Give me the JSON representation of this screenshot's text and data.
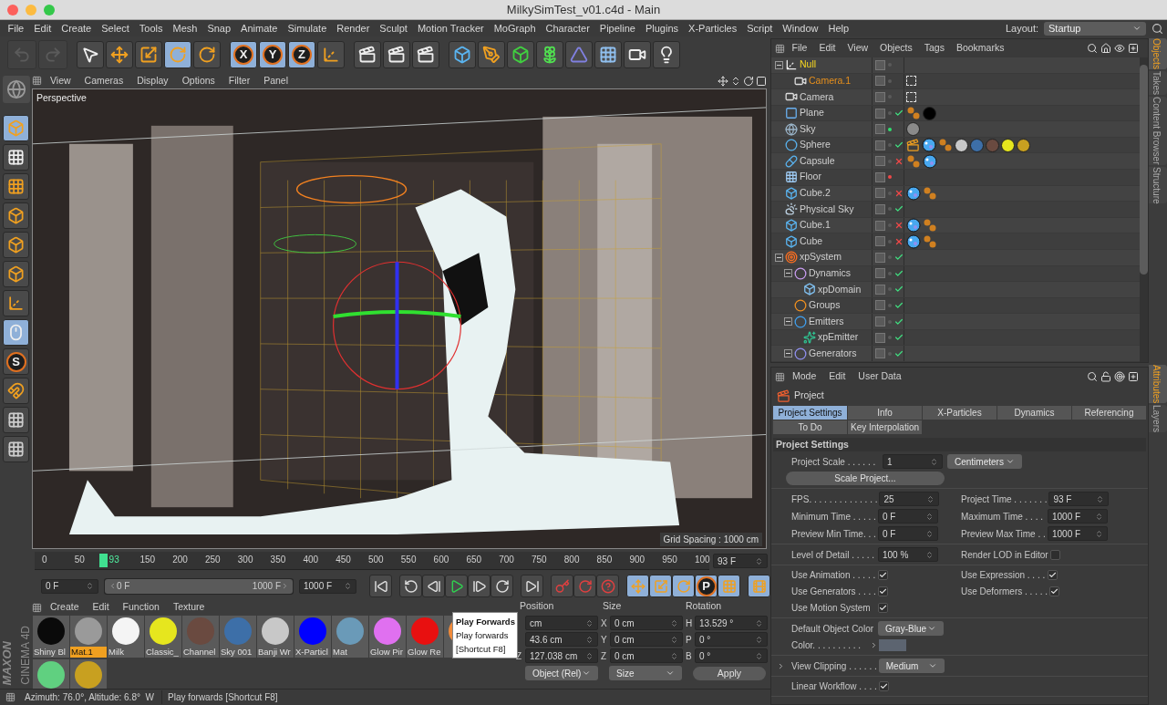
{
  "window": {
    "title": "MilkySimTest_v01.c4d - Main"
  },
  "menu": [
    "File",
    "Edit",
    "Create",
    "Select",
    "Tools",
    "Mesh",
    "Snap",
    "Animate",
    "Simulate",
    "Render",
    "Sculpt",
    "Motion Tracker",
    "MoGraph",
    "Character",
    "Pipeline",
    "Plugins",
    "X-Particles",
    "Script",
    "Window",
    "Help"
  ],
  "layout": {
    "label": "Layout:",
    "value": "Startup"
  },
  "toolbar": [
    [
      {
        "kind": "undo",
        "selected": false,
        "disabled": true
      },
      {
        "kind": "redo",
        "selected": false,
        "disabled": true
      }
    ],
    [
      {
        "kind": "select",
        "selected": false,
        "disabled": false
      },
      {
        "kind": "move",
        "selected": false,
        "disabled": false
      },
      {
        "kind": "scale",
        "selected": false,
        "disabled": false
      },
      {
        "kind": "rotate",
        "selected": true,
        "disabled": false
      },
      {
        "kind": "recent",
        "selected": false,
        "disabled": false
      }
    ],
    [
      {
        "kind": "axis",
        "label": "X",
        "selected": true,
        "disabled": false
      },
      {
        "kind": "axis",
        "label": "Y",
        "selected": true,
        "disabled": false
      },
      {
        "kind": "axis",
        "label": "Z",
        "selected": true,
        "disabled": false
      },
      {
        "kind": "coordinate-system",
        "selected": false,
        "disabled": false
      }
    ],
    [
      {
        "kind": "render-view",
        "selected": false,
        "disabled": false
      },
      {
        "kind": "render-picture",
        "selected": false,
        "disabled": false
      },
      {
        "kind": "render-settings",
        "selected": false,
        "disabled": false
      }
    ],
    [
      {
        "kind": "cube",
        "selected": false,
        "disabled": false
      },
      {
        "kind": "pen",
        "selected": false,
        "disabled": false
      },
      {
        "kind": "subdivision",
        "selected": false,
        "disabled": false
      },
      {
        "kind": "mograph",
        "selected": false,
        "disabled": false
      },
      {
        "kind": "deformer",
        "selected": false,
        "disabled": false
      },
      {
        "kind": "floor",
        "selected": false,
        "disabled": false
      },
      {
        "kind": "camera",
        "selected": false,
        "disabled": false
      },
      {
        "kind": "light",
        "selected": false,
        "disabled": false
      }
    ]
  ],
  "left_toolbar": [
    {
      "kind": "model",
      "selected": true
    },
    {
      "kind": "texture",
      "selected": false
    },
    {
      "kind": "workplane",
      "selected": false
    },
    {
      "kind": "points",
      "selected": false
    },
    {
      "kind": "edges",
      "selected": false
    },
    {
      "kind": "polygons",
      "selected": false
    },
    {
      "kind": "axis-mode",
      "selected": false
    },
    {
      "kind": "tweak",
      "selected": true
    },
    {
      "kind": "snap",
      "label": "S",
      "selected": false
    },
    {
      "kind": "magnet",
      "selected": false
    },
    {
      "kind": "lock-grid",
      "selected": false
    },
    {
      "kind": "grid-snap",
      "selected": false
    }
  ],
  "viewport": {
    "menu": [
      "View",
      "Cameras",
      "Display",
      "Options",
      "Filter",
      "Panel"
    ],
    "camera": "Perspective",
    "grid_spacing": "Grid Spacing : 1000 cm"
  },
  "timeline": {
    "ticks": [
      "0",
      "50",
      "150",
      "200",
      "250",
      "300",
      "350",
      "400",
      "450",
      "500",
      "550",
      "600",
      "650",
      "700",
      "750",
      "800",
      "850",
      "900",
      "950",
      "100"
    ],
    "current": "93",
    "level": 0.093,
    "frame": "93 F",
    "start": "0 F",
    "range": {
      "start": "0 F",
      "end": "1000 F",
      "level": 1
    },
    "end": "1000 F",
    "buttons": [
      [
        {
          "kind": "first-frame",
          "selected": false
        }
      ],
      [
        {
          "kind": "prev-key",
          "selected": false
        },
        {
          "kind": "prev-frame",
          "selected": false
        },
        {
          "kind": "play",
          "selected": false
        },
        {
          "kind": "next-frame",
          "selected": false
        },
        {
          "kind": "next-key",
          "selected": false
        }
      ],
      [
        {
          "kind": "last-frame",
          "selected": false
        }
      ],
      [
        {
          "kind": "record",
          "selected": false
        },
        {
          "kind": "auto-key",
          "selected": false
        },
        {
          "kind": "key-help",
          "selected": false
        }
      ],
      [
        {
          "kind": "move",
          "selected": true
        },
        {
          "kind": "scale",
          "selected": true
        },
        {
          "kind": "rotate",
          "selected": true
        },
        {
          "kind": "param",
          "label": "P",
          "selected": true
        },
        {
          "kind": "points-grid",
          "selected": true
        }
      ],
      [
        {
          "kind": "timeline",
          "selected": true
        }
      ]
    ]
  },
  "materials": {
    "logo": [
      "MAXON",
      "CINEMA 4D"
    ],
    "menu": [
      "Create",
      "Edit",
      "Function",
      "Texture"
    ],
    "items": [
      {
        "name": "Shiny Bl",
        "color": "#0a0a0a",
        "selected": false
      },
      {
        "name": "Mat.1",
        "color": "#9a9a9a",
        "selected": true
      },
      {
        "name": "Milk",
        "color": "#f4f4f4",
        "selected": false
      },
      {
        "name": "Classic_",
        "color": "#e6e61e",
        "selected": false
      },
      {
        "name": "Channel",
        "color": "#6a4a40",
        "selected": false
      },
      {
        "name": "Sky 001",
        "color": "#3d6fa8",
        "selected": false
      },
      {
        "name": "Banji Wr",
        "color": "#c8c8c8",
        "selected": false
      },
      {
        "name": "X-Particl",
        "color": "#0000ff",
        "selected": false
      },
      {
        "name": "Mat",
        "color": "#6a9ab8",
        "selected": false
      },
      {
        "name": "Glow Pir",
        "color": "#e070f0",
        "selected": false
      },
      {
        "name": "Glow Re",
        "color": "#e81010",
        "selected": false
      },
      {
        "color": "#f08a3a"
      },
      {
        "color": "#60d080"
      },
      {
        "color": "#c8a020"
      }
    ]
  },
  "tooltip": {
    "title": "Play Forwards",
    "text": "Play forwards",
    "shortcut": "[Shortcut F8]"
  },
  "coordinates": {
    "headers": [
      "Position",
      "Size",
      "Rotation"
    ],
    "rows": [
      {
        "position": {
          "value": "cm"
        },
        "size": {
          "axis": "X",
          "value": "0 cm"
        },
        "rotation": {
          "axis": "H",
          "value": "13.529 °"
        }
      },
      {
        "position": {
          "value": "43.6 cm"
        },
        "size": {
          "axis": "Y",
          "value": "0 cm"
        },
        "rotation": {
          "axis": "P",
          "value": "0 °"
        }
      },
      {
        "position": {
          "axis": "Z",
          "value": "127.038 cm"
        },
        "size": {
          "axis": "Z",
          "value": "0 cm"
        },
        "rotation": {
          "axis": "B",
          "value": "0 °"
        }
      }
    ],
    "mode": "Object (Rel)",
    "size_mode": "Size",
    "apply": "Apply"
  },
  "status_bar": {
    "view": "Azimuth: 76.0°, Altitude: 6.8°  W",
    "message": "Play forwards [Shortcut F8]"
  },
  "object_manager": {
    "menu": [
      "File",
      "Edit",
      "View",
      "Objects",
      "Tags",
      "Bookmarks"
    ],
    "objects": [
      {
        "name": "Null",
        "kind": "null",
        "selected": true,
        "expanded": true,
        "dots": {
          "color": "#5a5a5a"
        },
        "children": [
          {
            "name": "Camera.1",
            "kind": "camera",
            "selected": false,
            "dots": {
              "color": "#5a5a5a"
            },
            "tags": [
              {
                "kind": "target"
              }
            ]
          }
        ]
      },
      {
        "name": "Camera",
        "kind": "camera",
        "selected": false,
        "dots": {
          "color": "#5a5a5a"
        },
        "tags": [
          {
            "kind": "target"
          }
        ]
      },
      {
        "name": "Plane",
        "kind": "plane",
        "selected": false,
        "dots": {
          "color": "#5a5a5a"
        },
        "enabled": true,
        "tags": [
          {
            "kind": "particles"
          },
          {
            "kind": "material",
            "color": "#000000"
          }
        ]
      },
      {
        "name": "Sky",
        "kind": "sky",
        "selected": false,
        "dots": {
          "color": "#30e070"
        },
        "tags": [
          {
            "kind": "material",
            "color": "#8a8a8a"
          }
        ]
      },
      {
        "name": "Sphere",
        "kind": "sphere",
        "selected": false,
        "dots": {
          "color": "#5a5a5a"
        },
        "enabled": true,
        "tags": [
          {
            "kind": "render"
          },
          {
            "kind": "fluid"
          },
          {
            "kind": "particles"
          },
          {
            "kind": "material",
            "color": "#c8c8c8"
          },
          {
            "kind": "material",
            "color": "#3d6fa8"
          },
          {
            "kind": "material",
            "color": "#6a4a40"
          },
          {
            "kind": "material",
            "color": "#e6e61e"
          },
          {
            "kind": "material",
            "color": "#c8a020"
          }
        ]
      },
      {
        "name": "Capsule",
        "kind": "capsule",
        "selected": false,
        "dots": {
          "color": "#5a5a5a"
        },
        "enabled": false,
        "tags": [
          {
            "kind": "particles"
          },
          {
            "kind": "fluid"
          }
        ]
      },
      {
        "name": "Floor",
        "kind": "floor",
        "selected": false,
        "dots": {
          "color": "#f04848"
        }
      },
      {
        "name": "Cube.2",
        "kind": "cube",
        "selected": false,
        "dots": {
          "color": "#5a5a5a"
        },
        "enabled": false,
        "tags": [
          {
            "kind": "fluid"
          },
          {
            "kind": "particles"
          }
        ]
      },
      {
        "name": "Physical Sky",
        "kind": "physical-sky",
        "selected": false,
        "dots": {
          "color": "#5a5a5a"
        },
        "enabled": true
      },
      {
        "name": "Cube.1",
        "kind": "cube",
        "selected": false,
        "dots": {
          "color": "#5a5a5a"
        },
        "enabled": false,
        "tags": [
          {
            "kind": "fluid"
          },
          {
            "kind": "particles"
          }
        ]
      },
      {
        "name": "Cube",
        "kind": "cube",
        "selected": false,
        "dots": {
          "color": "#5a5a5a"
        },
        "enabled": false,
        "tags": [
          {
            "kind": "fluid"
          },
          {
            "kind": "particles"
          }
        ]
      },
      {
        "name": "xpSystem",
        "kind": "xp-system",
        "selected": false,
        "expanded": true,
        "dots": {
          "color": "#5a5a5a"
        },
        "enabled": true,
        "children": [
          {
            "name": "Dynamics",
            "kind": "xp-dynamics",
            "selected": false,
            "expanded": true,
            "dots": {
              "color": "#5a5a5a"
            },
            "enabled": true,
            "children": [
              {
                "name": "xpDomain",
                "kind": "xp-domain",
                "selected": false,
                "dots": {
                  "color": "#5a5a5a"
                },
                "enabled": true
              }
            ]
          },
          {
            "name": "Groups",
            "kind": "xp-groups",
            "selected": false,
            "dots": {
              "color": "#5a5a5a"
            },
            "enabled": true
          },
          {
            "name": "Emitters",
            "kind": "xp-emitters",
            "selected": false,
            "expanded": true,
            "dots": {
              "color": "#5a5a5a"
            },
            "enabled": true,
            "children": [
              {
                "name": "xpEmitter",
                "kind": "xp-emitter",
                "selected": false,
                "dots": {
                  "color": "#5a5a5a"
                },
                "enabled": true
              }
            ]
          },
          {
            "name": "Generators",
            "kind": "xp-generators",
            "selected": false,
            "expanded": true,
            "dots": {
              "color": "#5a5a5a"
            },
            "enabled": true
          }
        ]
      }
    ]
  },
  "side_tabs_top": [
    {
      "label": "Objects",
      "selected": true
    },
    {
      "label": "Takes",
      "selected": false
    },
    {
      "label": "Content Browser",
      "selected": false
    },
    {
      "label": "Structure",
      "selected": false
    }
  ],
  "side_tabs_bottom": [
    {
      "label": "Attributes",
      "selected": true
    },
    {
      "label": "Layers",
      "selected": false
    }
  ],
  "attributes": {
    "menu": [
      "Mode",
      "Edit",
      "User Data"
    ],
    "title": "Project",
    "tabs": [
      [
        {
          "label": "Project Settings",
          "selected": true
        },
        {
          "label": "Info",
          "selected": false
        },
        {
          "label": "X-Particles",
          "selected": false
        },
        {
          "label": "Dynamics",
          "selected": false
        },
        {
          "label": "Referencing",
          "selected": false
        }
      ],
      [
        {
          "label": "To Do",
          "selected": false
        },
        {
          "label": "Key Interpolation",
          "selected": false
        }
      ]
    ],
    "section": "Project Settings",
    "groups": [
      [
        [
          {
            "kind": "number-unit",
            "label": "Project Scale . . . . . .",
            "value": "1",
            "unit": "Centimeters"
          }
        ],
        [
          {
            "kind": "button",
            "label": "Scale Project..."
          }
        ]
      ],
      [
        [
          {
            "kind": "number",
            "label": "FPS. . . . . . . . . . . . . .",
            "value": "25"
          },
          {
            "kind": "number",
            "label": "Project Time . . . . . . .",
            "value": "93 F"
          }
        ],
        [
          {
            "kind": "number",
            "label": "Minimum Time . . . . .",
            "value": "0 F"
          },
          {
            "kind": "number",
            "label": "Maximum Time . . . .",
            "value": "1000 F"
          }
        ],
        [
          {
            "kind": "number",
            "label": "Preview Min Time. . .",
            "value": "0 F"
          },
          {
            "kind": "number",
            "label": "Preview Max Time . .",
            "value": "1000 F"
          }
        ]
      ],
      [
        [
          {
            "kind": "number",
            "label": "Level of Detail . . . . .",
            "value": "100 %"
          },
          {
            "kind": "checkbox",
            "label": "Render LOD in Editor",
            "checked": false
          }
        ]
      ],
      [
        [
          {
            "kind": "checkbox",
            "label": "Use Animation . . . . .",
            "checked": true
          },
          {
            "kind": "checkbox",
            "label": "Use Expression . . . .",
            "checked": true
          }
        ],
        [
          {
            "kind": "checkbox",
            "label": "Use Generators . . . .",
            "checked": true
          },
          {
            "kind": "checkbox",
            "label": "Use Deformers . . . . .",
            "checked": true
          }
        ],
        [
          {
            "kind": "checkbox",
            "label": "Use Motion System",
            "checked": true
          }
        ]
      ],
      [
        [
          {
            "kind": "dropdown",
            "label": "Default Object Color",
            "value": "Gray-Blue"
          }
        ],
        [
          {
            "kind": "color",
            "label": "Color. . . . . . . . . .",
            "color": "#5c6470",
            "expanded": false
          }
        ]
      ],
      [
        [
          {
            "kind": "dropdown",
            "label": "View Clipping . . . . . .",
            "value": "Medium",
            "expanded": false
          }
        ]
      ],
      [
        [
          {
            "kind": "checkbox",
            "label": "Linear Workflow . . . .",
            "checked": true
          }
        ]
      ]
    ]
  }
}
